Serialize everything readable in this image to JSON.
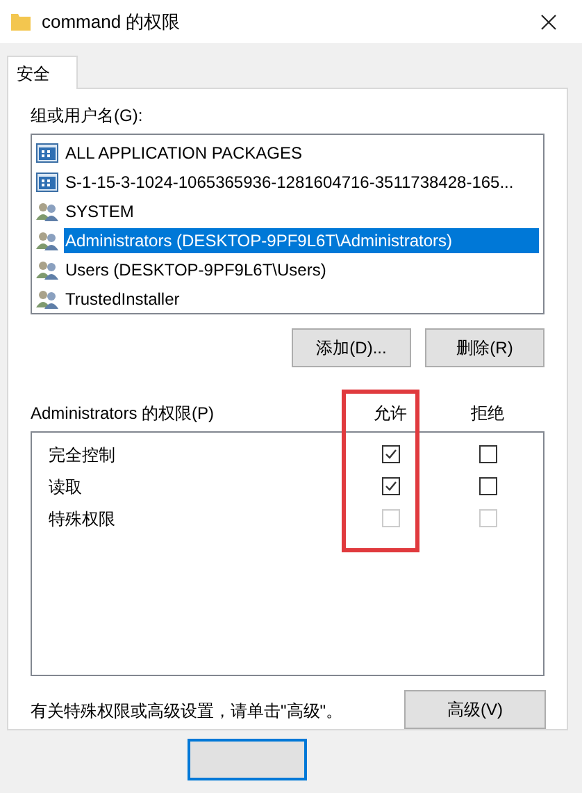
{
  "window": {
    "title": "command 的权限"
  },
  "tabs": [
    {
      "label": "安全",
      "selected": true
    }
  ],
  "users_label": "组或用户名(G):",
  "users": [
    {
      "name": "ALL APPLICATION PACKAGES",
      "kind": "package",
      "selected": false
    },
    {
      "name": "S-1-15-3-1024-1065365936-1281604716-3511738428-165...",
      "kind": "package",
      "selected": false
    },
    {
      "name": "SYSTEM",
      "kind": "group",
      "selected": false
    },
    {
      "name": "Administrators (DESKTOP-9PF9L6T\\Administrators)",
      "kind": "group",
      "selected": true
    },
    {
      "name": "Users (DESKTOP-9PF9L6T\\Users)",
      "kind": "group",
      "selected": false
    },
    {
      "name": "TrustedInstaller",
      "kind": "group",
      "selected": false
    }
  ],
  "user_buttons": [
    "添加(D)...",
    "删除(R)"
  ],
  "permissions": {
    "label": "Administrators 的权限(P)",
    "columns": [
      {
        "label": "允许",
        "highlighted": true
      },
      {
        "label": "拒绝",
        "highlighted": false
      }
    ],
    "rows": [
      {
        "name": "完全控制",
        "allow": {
          "checked": true,
          "disabled": false
        },
        "deny": {
          "checked": false,
          "disabled": false
        }
      },
      {
        "name": "读取",
        "allow": {
          "checked": true,
          "disabled": false
        },
        "deny": {
          "checked": false,
          "disabled": false
        }
      },
      {
        "name": "特殊权限",
        "allow": {
          "checked": false,
          "disabled": true
        },
        "deny": {
          "checked": false,
          "disabled": true
        }
      }
    ]
  },
  "advanced_note": "有关特殊权限或高级设置，请单击\"高级\"。",
  "advanced_button": "高级(V)"
}
